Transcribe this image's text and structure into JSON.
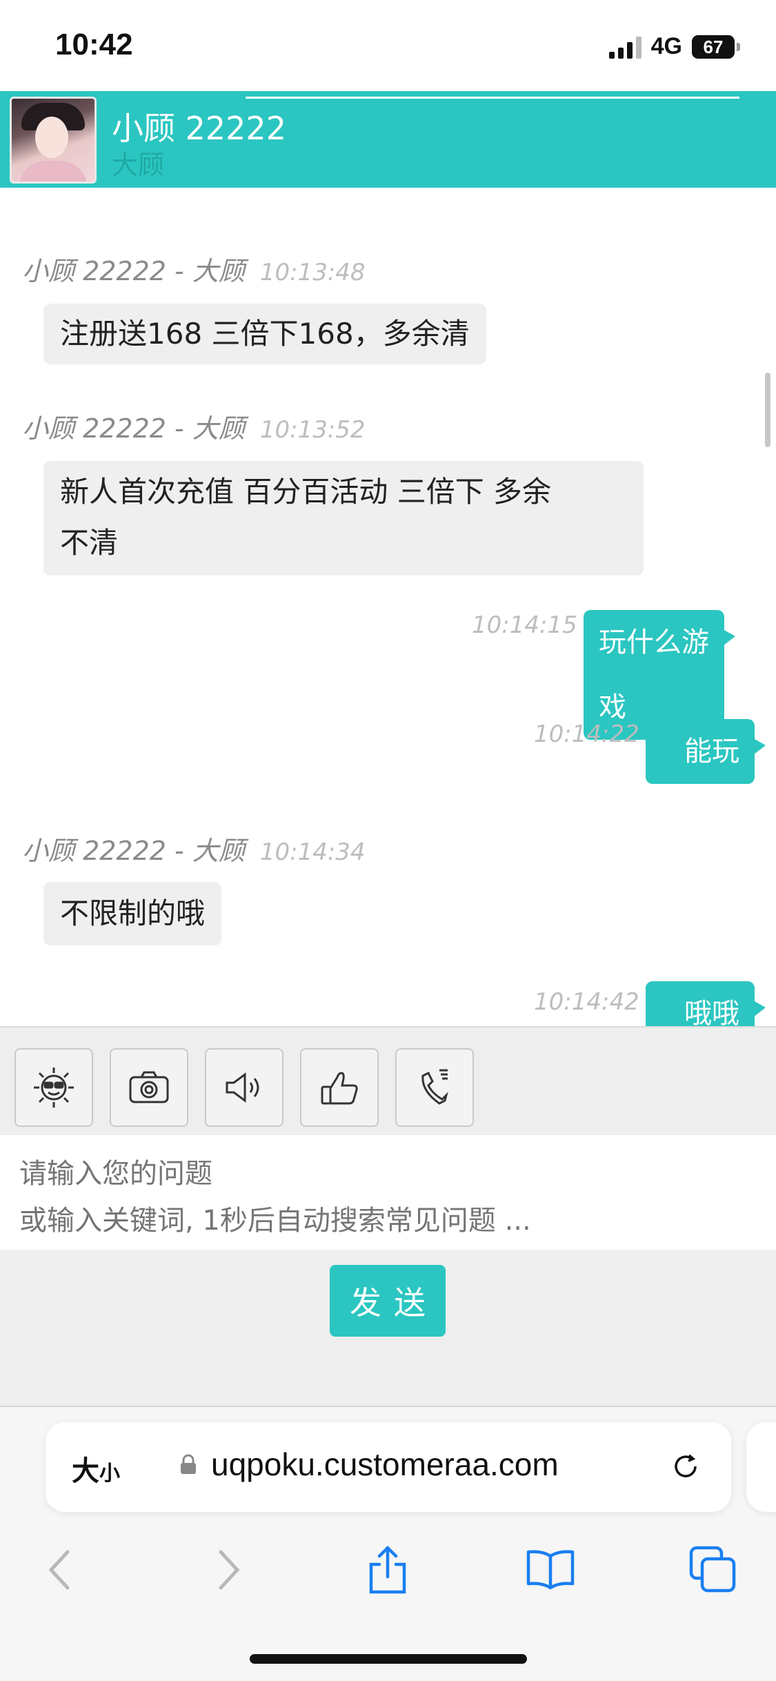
{
  "status_bar": {
    "time": "10:42",
    "network": "4G",
    "battery": "67"
  },
  "header": {
    "title": "小顾 22222",
    "subtitle": "大顾"
  },
  "messages": [
    {
      "sender": "小顾 22222 - 大顾",
      "time": "10:13:48",
      "text": "注册送168 三倍下168，多余清"
    },
    {
      "sender": "小顾 22222 - 大顾",
      "time": "10:13:52",
      "text_line1": "新人首次充值 百分百活动 三倍下 多余",
      "text_line2": "不清"
    },
    {
      "time": "10:14:15",
      "text": "玩什么游戏"
    },
    {
      "time": "10:14:22",
      "text": "能玩"
    },
    {
      "sender": "小顾 22222 - 大顾",
      "time": "10:14:34",
      "text": "不限制的哦"
    },
    {
      "time": "10:14:42",
      "text": "哦哦"
    }
  ],
  "toolbar": {
    "icons": [
      "emoji-icon",
      "camera-icon",
      "voice-icon",
      "thumbs-up-icon",
      "phone-icon"
    ]
  },
  "input": {
    "placeholder": "请输入您的问题\n或输入关键词, 1秒后自动搜索常见问题 ..."
  },
  "send_label": "发送",
  "browser": {
    "aa_big": "大",
    "aa_small": "小",
    "url": "uqpoku.customeraa.com"
  },
  "colors": {
    "accent": "#2bc6c1",
    "bubble_in": "#efefef",
    "toolbar_bg": "#eeeeee"
  }
}
